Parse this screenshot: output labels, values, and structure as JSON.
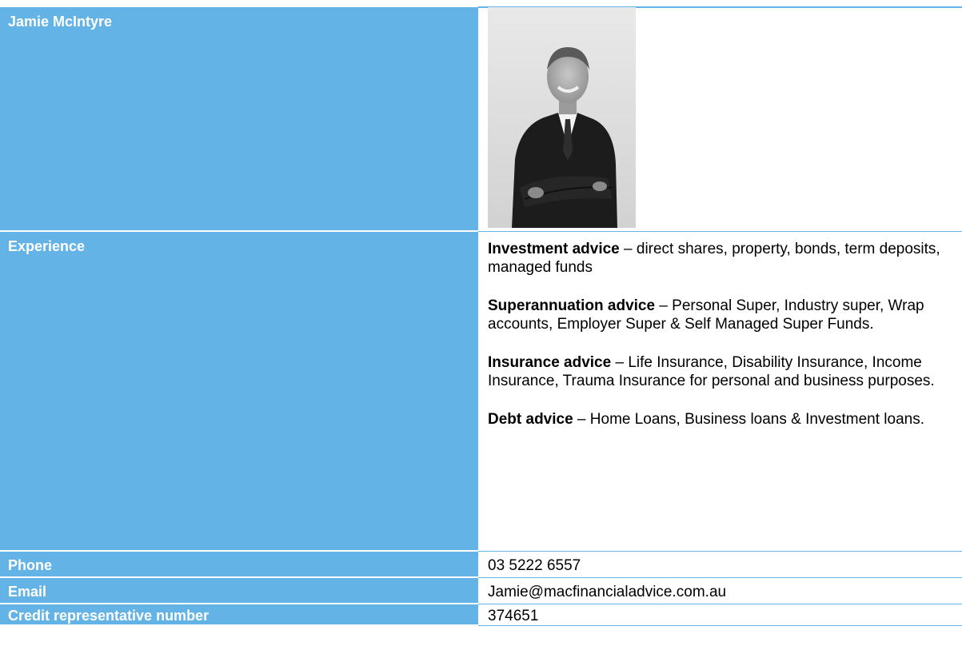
{
  "profile": {
    "name": "Jamie McIntyre",
    "photo_alt": "portrait-photo"
  },
  "experience": {
    "label": "Experience",
    "items": [
      {
        "title": "Investment advice",
        "text": " – direct shares, property, bonds, term deposits, managed funds"
      },
      {
        "title": "Superannuation advice",
        "text": " – Personal Super, Industry super, Wrap accounts, Employer Super & Self Managed Super Funds."
      },
      {
        "title": "Insurance advice",
        "text": " – Life Insurance, Disability Insurance, Income Insurance, Trauma Insurance for personal and business purposes."
      },
      {
        "title": "Debt advice",
        "text": " – Home Loans, Business loans & Investment loans."
      }
    ]
  },
  "phone": {
    "label": "Phone",
    "value": "03 5222 6557"
  },
  "email": {
    "label": "Email",
    "value": "Jamie@macfinancialadvice.com.au"
  },
  "credit": {
    "label": "Credit representative number",
    "value": "374651"
  },
  "colors": {
    "label_bg": "#63b3e6",
    "label_text": "#ffffff",
    "value_text": "#000000"
  }
}
